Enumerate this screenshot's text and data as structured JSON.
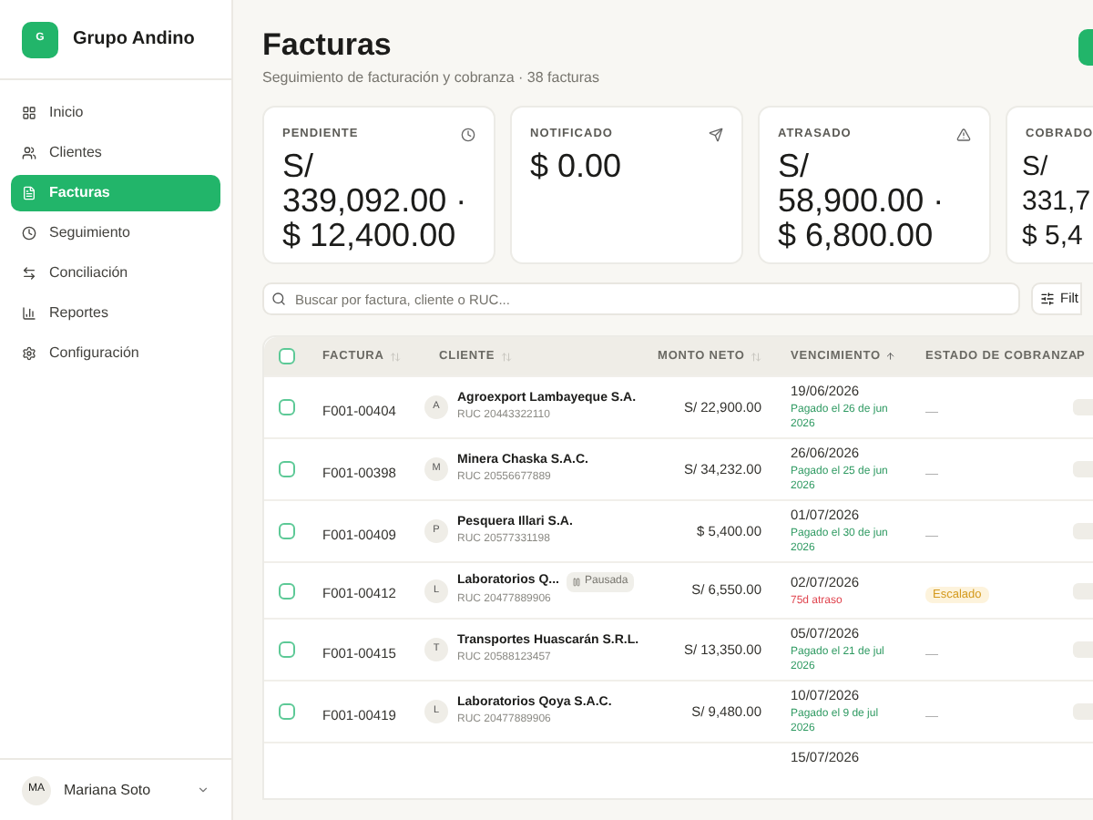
{
  "sidebar": {
    "logo": "G",
    "brand": "Grupo Andino",
    "items": [
      {
        "label": "Inicio",
        "selected": false
      },
      {
        "label": "Clientes",
        "selected": false
      },
      {
        "label": "Facturas",
        "selected": true
      },
      {
        "label": "Seguimiento",
        "selected": false
      },
      {
        "label": "Conciliación",
        "selected": false
      },
      {
        "label": "Reportes",
        "selected": false
      },
      {
        "label": "Configuración",
        "selected": false
      }
    ],
    "user": {
      "initials": "MA",
      "name": "Mariana Soto"
    }
  },
  "header": {
    "title": "Facturas",
    "subtitle": "Seguimiento de facturación y cobranza · 38 facturas"
  },
  "cards": [
    {
      "label": "PENDIENTE",
      "value": "S/ 339,092.00 · $ 12,400.00"
    },
    {
      "label": "NOTIFICADO",
      "value": "$ 0.00"
    },
    {
      "label": "ATRASADO",
      "value": "S/ 58,900.00 · $ 6,800.00"
    },
    {
      "label": "COBRADO",
      "value": "S/ 331,7 $ 5,4"
    }
  ],
  "search": {
    "placeholder": "Buscar por factura, cliente o RUC..."
  },
  "filter_button": "Filt",
  "table": {
    "select_all": {
      "checked": false
    },
    "columns": [
      {
        "label": "FACTURA",
        "sorted": false
      },
      {
        "label": "CLIENTE",
        "sorted": false
      },
      {
        "label": "MONTO NETO",
        "sorted": false
      },
      {
        "label": "VENCIMIENTO",
        "sorted": true
      },
      {
        "label": "ESTADO DE COBRANZA"
      },
      {
        "label": "P"
      }
    ],
    "rows": [
      {
        "checked": false,
        "invoice": "F001-00404",
        "avatar": "A",
        "client": "Agroexport Lambayeque S.A.",
        "ruc": "RUC 20443322110",
        "amount": "S/ 22,900.00",
        "due": "19/06/2026",
        "note": {
          "kind": "paid",
          "text": "Pagado el 26 de jun 2026"
        },
        "status": {
          "kind": "none",
          "label": "—"
        }
      },
      {
        "checked": false,
        "invoice": "F001-00398",
        "avatar": "M",
        "client": "Minera Chaska S.A.C.",
        "ruc": "RUC 20556677889",
        "amount": "S/ 34,232.00",
        "due": "26/06/2026",
        "note": {
          "kind": "paid",
          "text": "Pagado el 25 de jun 2026"
        },
        "status": {
          "kind": "none",
          "label": "—"
        }
      },
      {
        "checked": false,
        "invoice": "F001-00409",
        "avatar": "P",
        "client": "Pesquera Illari S.A.",
        "ruc": "RUC 20577331198",
        "amount": "$ 5,400.00",
        "due": "01/07/2026",
        "note": {
          "kind": "paid",
          "text": "Pagado el 30 de jun 2026"
        },
        "status": {
          "kind": "none",
          "label": "—"
        }
      },
      {
        "checked": false,
        "invoice": "F001-00412",
        "avatar": "L",
        "client": "Laboratorios Q...",
        "tag": "Pausada",
        "ruc": "RUC 20477889906",
        "amount": "S/ 6,550.00",
        "due": "02/07/2026",
        "note": {
          "kind": "overdue",
          "text": "75d atraso"
        },
        "status": {
          "kind": "escalated",
          "label": "Escalado"
        }
      },
      {
        "checked": false,
        "invoice": "F001-00415",
        "avatar": "T",
        "client": "Transportes Huascarán S.R.L.",
        "ruc": "RUC 20588123457",
        "amount": "S/ 13,350.00",
        "due": "05/07/2026",
        "note": {
          "kind": "paid",
          "text": "Pagado el 21 de jul 2026"
        },
        "status": {
          "kind": "none",
          "label": "—"
        }
      },
      {
        "checked": false,
        "invoice": "F001-00419",
        "avatar": "L",
        "client": "Laboratorios Qoya S.A.C.",
        "ruc": "RUC 20477889906",
        "amount": "S/ 9,480.00",
        "due": "10/07/2026",
        "note": {
          "kind": "paid",
          "text": "Pagado el 9 de jul 2026"
        },
        "status": {
          "kind": "none",
          "label": "—"
        }
      },
      {
        "due": "15/07/2026"
      }
    ]
  }
}
